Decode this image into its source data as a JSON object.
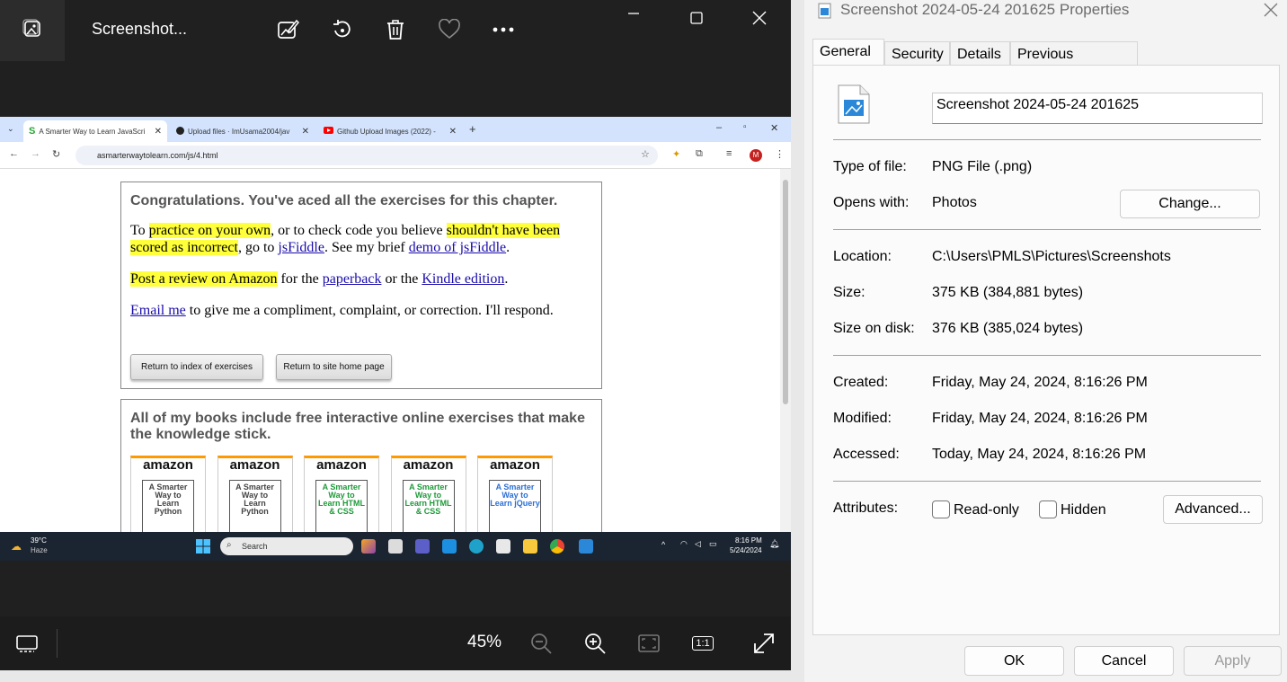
{
  "photos": {
    "title": "Screenshot...",
    "zoom": "45%",
    "toolbar_icons": [
      "gallery-icon",
      "edit-icon",
      "rotate-icon",
      "delete-icon",
      "favorite-icon",
      "more-icon"
    ],
    "bottom_icons": [
      "filmstrip-icon",
      "zoom-out-icon",
      "zoom-in-icon",
      "fit-icon",
      "actual-size-icon",
      "fullscreen-icon"
    ],
    "actual_size_label": "1:1"
  },
  "shot": {
    "tabs": [
      {
        "label": "A Smarter Way to Learn JavaScri",
        "favicon": "S"
      },
      {
        "label": "Upload files · ImUsama2004/jav",
        "favicon": "github-icon"
      },
      {
        "label": "Github Upload Images (2022) -",
        "favicon": "youtube-icon"
      }
    ],
    "url": "asmarterwaytolearn.com/js/4.html",
    "profile_initial": "M",
    "box1": {
      "heading": "Congratulations. You've aced all the exercises for this chapter.",
      "p1_a": "To ",
      "p1_hl1": "practice on your own",
      "p1_b": ", or to check code you believe ",
      "p1_hl2": "shouldn't have been scored as incorrect",
      "p1_c": ", go to ",
      "p1_link1": "jsFiddle",
      "p1_d": ". See my brief ",
      "p1_link2": "demo of jsFiddle",
      "p1_e": ".",
      "p2_hl": "Post a review on Amazon",
      "p2_a": " for the ",
      "p2_link1": "paperback",
      "p2_b": " or the ",
      "p2_link2": "Kindle edition",
      "p2_c": ".",
      "p3_link": "Email me",
      "p3_a": " to give me a compliment, complaint, or correction. I'll respond.",
      "btn_index": "Return to index of exercises",
      "btn_home": "Return to site home page"
    },
    "box2": {
      "heading": "All of my books include free interactive online exercises that make the knowledge stick.",
      "brand": "amazon",
      "books": [
        {
          "title": "A Smarter Way to Learn Python",
          "color": "#444444"
        },
        {
          "title": "A Smarter Way to Learn Python",
          "color": "#444444"
        },
        {
          "title": "A Smarter Way to Learn HTML & CSS",
          "color": "#1e9a3a"
        },
        {
          "title": "A Smarter Way to Learn HTML & CSS",
          "color": "#1e9a3a"
        },
        {
          "title": "A Smarter Way to Learn jQuery",
          "color": "#2a6fd6"
        }
      ]
    },
    "taskbar": {
      "weather_temp": "39°C",
      "weather_desc": "Haze",
      "search_placeholder": "Search",
      "time": "8:16 PM",
      "date": "5/24/2024"
    }
  },
  "props": {
    "title": "Screenshot 2024-05-24 201625 Properties",
    "tabs": [
      "General",
      "Security",
      "Details",
      "Previous Versions"
    ],
    "file_name": "Screenshot 2024-05-24 201625",
    "type_label": "Type of file:",
    "type_value": "PNG File (.png)",
    "opens_label": "Opens with:",
    "opens_value": "Photos",
    "change_btn": "Change...",
    "location_label": "Location:",
    "location_value": "C:\\Users\\PMLS\\Pictures\\Screenshots",
    "size_label": "Size:",
    "size_value": "375 KB (384,881 bytes)",
    "disk_label": "Size on disk:",
    "disk_value": "376 KB (385,024 bytes)",
    "created_label": "Created:",
    "created_value": "Friday, May 24, 2024, 8:16:26 PM",
    "modified_label": "Modified:",
    "modified_value": "Friday, May 24, 2024, 8:16:26 PM",
    "accessed_label": "Accessed:",
    "accessed_value": "Today, May 24, 2024, 8:16:26 PM",
    "attributes_label": "Attributes:",
    "readonly_label": "Read-only",
    "hidden_label": "Hidden",
    "advanced_btn": "Advanced...",
    "ok": "OK",
    "cancel": "Cancel",
    "apply": "Apply"
  }
}
